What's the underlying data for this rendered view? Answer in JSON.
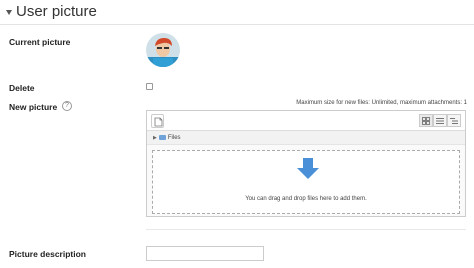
{
  "section": {
    "title": "User picture"
  },
  "current_picture": {
    "label": "Current picture"
  },
  "delete": {
    "label": "Delete"
  },
  "new_picture": {
    "label": "New picture",
    "help_symbol": "?",
    "max_size_text": "Maximum size for new files: Unlimited, maximum attachments: 1",
    "path_label": "Files",
    "drop_text": "You can drag and drop files here to add them."
  },
  "picture_description": {
    "label": "Picture description",
    "value": ""
  },
  "colors": {
    "accent": "#4a90d9",
    "folder": "#6ea2d8",
    "border": "#cccccc"
  }
}
